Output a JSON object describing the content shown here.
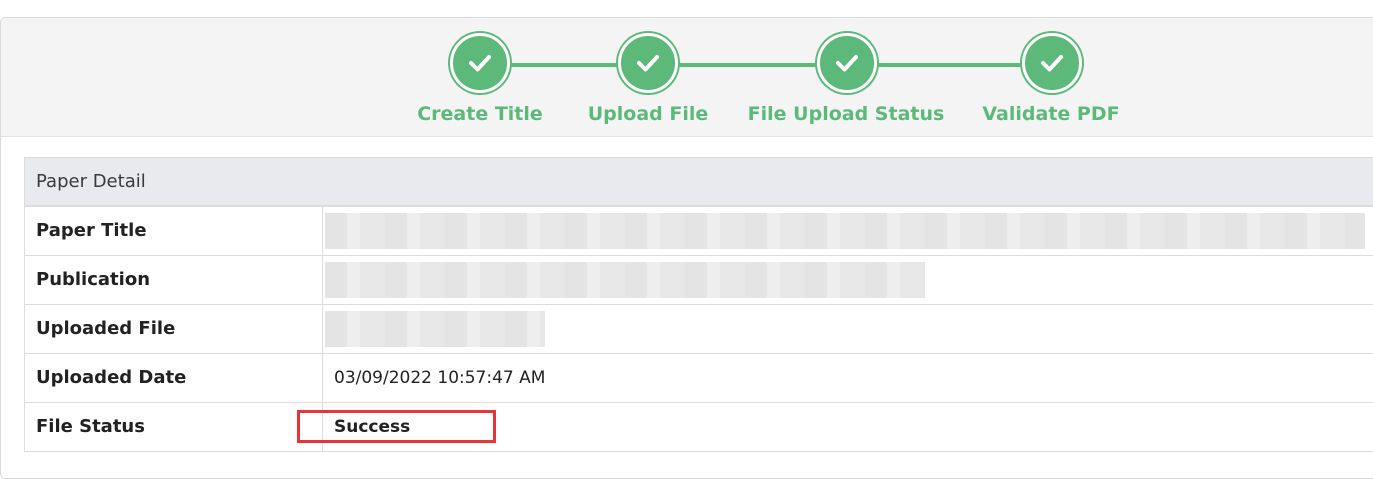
{
  "stepper": {
    "steps": [
      {
        "label": "Create Title",
        "icon": "check-icon",
        "status": "complete"
      },
      {
        "label": "Upload File",
        "icon": "check-icon",
        "status": "complete"
      },
      {
        "label": "File Upload Status",
        "icon": "check-icon",
        "status": "complete"
      },
      {
        "label": "Validate PDF",
        "icon": "check-icon",
        "status": "complete"
      }
    ],
    "accent_color": "#5cb97a"
  },
  "detail": {
    "header": "Paper Detail",
    "rows": [
      {
        "label": "Paper Title",
        "value": ""
      },
      {
        "label": "Publication",
        "value": ""
      },
      {
        "label": "Uploaded File",
        "value": ""
      },
      {
        "label": "Uploaded Date",
        "value": "03/09/2022 10:57:47 AM"
      },
      {
        "label": "File Status",
        "value": "Success"
      }
    ]
  },
  "annotation": {
    "color": "#e8333a"
  }
}
